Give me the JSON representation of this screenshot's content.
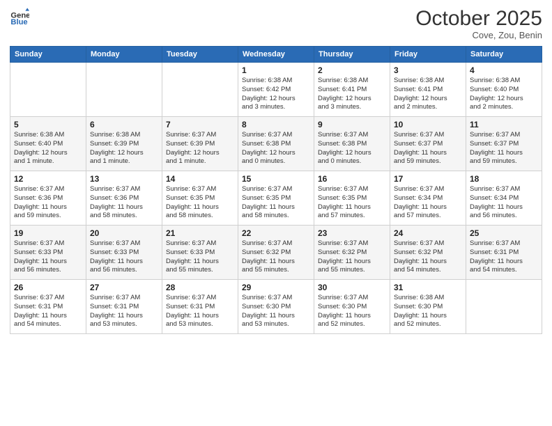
{
  "logo": {
    "general": "General",
    "blue": "Blue"
  },
  "title": "October 2025",
  "subtitle": "Cove, Zou, Benin",
  "days_header": [
    "Sunday",
    "Monday",
    "Tuesday",
    "Wednesday",
    "Thursday",
    "Friday",
    "Saturday"
  ],
  "weeks": [
    [
      {
        "day": "",
        "info": ""
      },
      {
        "day": "",
        "info": ""
      },
      {
        "day": "",
        "info": ""
      },
      {
        "day": "1",
        "info": "Sunrise: 6:38 AM\nSunset: 6:42 PM\nDaylight: 12 hours\nand 3 minutes."
      },
      {
        "day": "2",
        "info": "Sunrise: 6:38 AM\nSunset: 6:41 PM\nDaylight: 12 hours\nand 3 minutes."
      },
      {
        "day": "3",
        "info": "Sunrise: 6:38 AM\nSunset: 6:41 PM\nDaylight: 12 hours\nand 2 minutes."
      },
      {
        "day": "4",
        "info": "Sunrise: 6:38 AM\nSunset: 6:40 PM\nDaylight: 12 hours\nand 2 minutes."
      }
    ],
    [
      {
        "day": "5",
        "info": "Sunrise: 6:38 AM\nSunset: 6:40 PM\nDaylight: 12 hours\nand 1 minute."
      },
      {
        "day": "6",
        "info": "Sunrise: 6:38 AM\nSunset: 6:39 PM\nDaylight: 12 hours\nand 1 minute."
      },
      {
        "day": "7",
        "info": "Sunrise: 6:37 AM\nSunset: 6:39 PM\nDaylight: 12 hours\nand 1 minute."
      },
      {
        "day": "8",
        "info": "Sunrise: 6:37 AM\nSunset: 6:38 PM\nDaylight: 12 hours\nand 0 minutes."
      },
      {
        "day": "9",
        "info": "Sunrise: 6:37 AM\nSunset: 6:38 PM\nDaylight: 12 hours\nand 0 minutes."
      },
      {
        "day": "10",
        "info": "Sunrise: 6:37 AM\nSunset: 6:37 PM\nDaylight: 11 hours\nand 59 minutes."
      },
      {
        "day": "11",
        "info": "Sunrise: 6:37 AM\nSunset: 6:37 PM\nDaylight: 11 hours\nand 59 minutes."
      }
    ],
    [
      {
        "day": "12",
        "info": "Sunrise: 6:37 AM\nSunset: 6:36 PM\nDaylight: 11 hours\nand 59 minutes."
      },
      {
        "day": "13",
        "info": "Sunrise: 6:37 AM\nSunset: 6:36 PM\nDaylight: 11 hours\nand 58 minutes."
      },
      {
        "day": "14",
        "info": "Sunrise: 6:37 AM\nSunset: 6:35 PM\nDaylight: 11 hours\nand 58 minutes."
      },
      {
        "day": "15",
        "info": "Sunrise: 6:37 AM\nSunset: 6:35 PM\nDaylight: 11 hours\nand 58 minutes."
      },
      {
        "day": "16",
        "info": "Sunrise: 6:37 AM\nSunset: 6:35 PM\nDaylight: 11 hours\nand 57 minutes."
      },
      {
        "day": "17",
        "info": "Sunrise: 6:37 AM\nSunset: 6:34 PM\nDaylight: 11 hours\nand 57 minutes."
      },
      {
        "day": "18",
        "info": "Sunrise: 6:37 AM\nSunset: 6:34 PM\nDaylight: 11 hours\nand 56 minutes."
      }
    ],
    [
      {
        "day": "19",
        "info": "Sunrise: 6:37 AM\nSunset: 6:33 PM\nDaylight: 11 hours\nand 56 minutes."
      },
      {
        "day": "20",
        "info": "Sunrise: 6:37 AM\nSunset: 6:33 PM\nDaylight: 11 hours\nand 56 minutes."
      },
      {
        "day": "21",
        "info": "Sunrise: 6:37 AM\nSunset: 6:33 PM\nDaylight: 11 hours\nand 55 minutes."
      },
      {
        "day": "22",
        "info": "Sunrise: 6:37 AM\nSunset: 6:32 PM\nDaylight: 11 hours\nand 55 minutes."
      },
      {
        "day": "23",
        "info": "Sunrise: 6:37 AM\nSunset: 6:32 PM\nDaylight: 11 hours\nand 55 minutes."
      },
      {
        "day": "24",
        "info": "Sunrise: 6:37 AM\nSunset: 6:32 PM\nDaylight: 11 hours\nand 54 minutes."
      },
      {
        "day": "25",
        "info": "Sunrise: 6:37 AM\nSunset: 6:31 PM\nDaylight: 11 hours\nand 54 minutes."
      }
    ],
    [
      {
        "day": "26",
        "info": "Sunrise: 6:37 AM\nSunset: 6:31 PM\nDaylight: 11 hours\nand 54 minutes."
      },
      {
        "day": "27",
        "info": "Sunrise: 6:37 AM\nSunset: 6:31 PM\nDaylight: 11 hours\nand 53 minutes."
      },
      {
        "day": "28",
        "info": "Sunrise: 6:37 AM\nSunset: 6:31 PM\nDaylight: 11 hours\nand 53 minutes."
      },
      {
        "day": "29",
        "info": "Sunrise: 6:37 AM\nSunset: 6:30 PM\nDaylight: 11 hours\nand 53 minutes."
      },
      {
        "day": "30",
        "info": "Sunrise: 6:37 AM\nSunset: 6:30 PM\nDaylight: 11 hours\nand 52 minutes."
      },
      {
        "day": "31",
        "info": "Sunrise: 6:38 AM\nSunset: 6:30 PM\nDaylight: 11 hours\nand 52 minutes."
      },
      {
        "day": "",
        "info": ""
      }
    ]
  ]
}
